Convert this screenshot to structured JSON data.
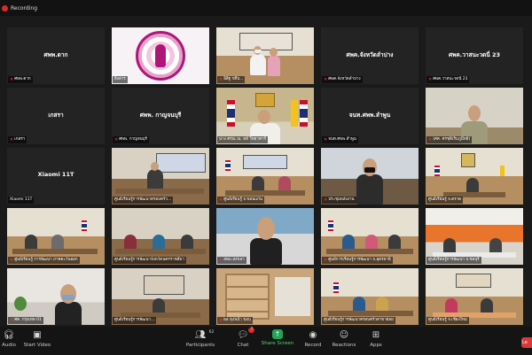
{
  "recording": {
    "label": "Recording"
  },
  "tiles": [
    {
      "center": "ศพพ.ตาก",
      "caption": "ศพพ.ตาก"
    },
    {
      "center": "",
      "caption": "สิงสาร"
    },
    {
      "center": "",
      "caption": "อิสิฐ ขจิ๊บ..."
    },
    {
      "center": "ศพค.จังหวัดลำปาง",
      "caption": "ศพค.จังหวัดลำปาง"
    },
    {
      "center": "ศพค.วาสนะวดนี่ 23",
      "caption": "ศพค.วาสนะวดนี่ 23"
    },
    {
      "center": "เกสรา",
      "caption": "เกสรา"
    },
    {
      "center": "ศพพ. กาญจนบุรี",
      "caption": "ศพพ. กาญจนบุรี"
    },
    {
      "center": "",
      "caption": "นาง ศรณ ณ. หลี วิทยาคาร์"
    },
    {
      "center": "จนท.ศพพ.ลำพูน",
      "caption": "จนท.ศพพ.ลำพูน"
    },
    {
      "center": "",
      "caption": "(ศค. ศรชุติเริ่มภูมิ์ทธี)"
    },
    {
      "center": "Xiaomi 11T",
      "caption": "Xiaomi 11T"
    },
    {
      "center": "",
      "caption": "ศูนย์เรียนรู้การพัฒนาครอบครัว..."
    },
    {
      "center": "",
      "caption": "ศูนย์เรียนรู้ จ.ขอนแก่น"
    },
    {
      "center": "",
      "caption": "ประชุมพลังงาน"
    },
    {
      "center": "",
      "caption": "ศูนย์เรียนรู้ จ.ตราด"
    },
    {
      "center": "",
      "caption": "ศูนย์เรียนรู้ การพัฒนา ภาคตะวันออก"
    },
    {
      "center": "",
      "caption": "ศูนย์เรียนรู้การพัฒนาจังหวัดนครราชสีมา"
    },
    {
      "center": "",
      "caption": "สพม.สงขลา"
    },
    {
      "center": "",
      "caption": "ศูนย์การเรียนรู้การพัฒนา จ.อุดรธานี"
    },
    {
      "center": "",
      "caption": "ศูนย์เรียนรู้การพัฒนา จ.ชลบุรี"
    },
    {
      "center": "",
      "caption": "ศค. กรุงเทพ 01"
    },
    {
      "center": "",
      "caption": "ศูนย์เรียนรู้การพัฒนา..."
    },
    {
      "center": "",
      "caption": "ผล ทุงพนำ ขอบ"
    },
    {
      "center": "",
      "caption": "ศูนย์เรียนรู้การพัฒนาครอบครัวสาขาย่อย"
    },
    {
      "center": "",
      "caption": "ศูนย์เรียนรู้ จ.เชียงใหม่"
    }
  ],
  "toolbar": {
    "audio": "Audio",
    "start_video": "Start Video",
    "participants": "Participants",
    "participants_count": "62",
    "chat": "Chat",
    "chat_badge": "7",
    "share_screen": "Share Screen",
    "record": "Record",
    "reactions": "Reactions",
    "apps": "Apps",
    "leave": "Le"
  },
  "colors": {
    "active_border": "#f5d33a",
    "share_green": "#23a455",
    "record_red": "#e02828"
  }
}
